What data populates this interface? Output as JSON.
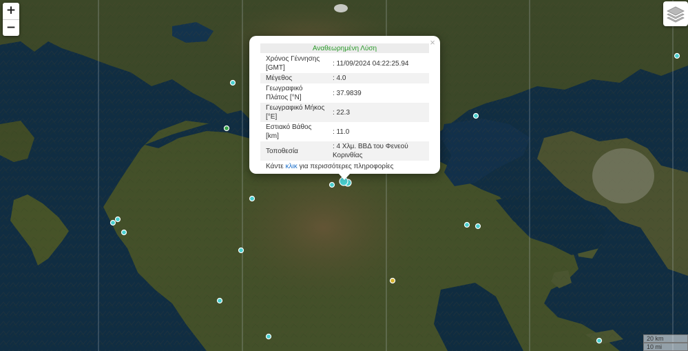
{
  "map": {
    "controls": {
      "zoom_in_label": "+",
      "zoom_out_label": "−",
      "layers_icon": "layers-icon"
    },
    "scale": {
      "km_label": "20 km",
      "mi_label": "10 mi"
    },
    "colors": {
      "sea": "#0f2c40",
      "land": "#3f4a2a",
      "marker_default": "#49cfcf",
      "marker_yellow": "#d6b32d",
      "marker_green": "#3aa64a",
      "popup_title": "#2a9a2a",
      "link": "#1a6fc9"
    },
    "markers": [
      {
        "name": "quake-marker-selected",
        "color": "#49cfcf",
        "selected": true
      },
      {
        "name": "quake-marker",
        "color": "#49cfcf"
      },
      {
        "name": "quake-marker-yellow",
        "color": "#d6b32d"
      },
      {
        "name": "quake-marker-green",
        "color": "#3aa64a"
      }
    ]
  },
  "popup": {
    "title": "Αναθεωρημένη Λύση",
    "close_label": "×",
    "rows": [
      {
        "label": "Χρόνος Γέννησης [GMT]",
        "value": ": 11/09/2024 04:22:25.94"
      },
      {
        "label": "Μέγεθος",
        "value": ": 4.0"
      },
      {
        "label": "Γεωγραφικό Πλάτος [°N]",
        "value": ": 37.9839"
      },
      {
        "label": "Γεωγραφικό Μήκος [°E]",
        "value": ": 22.3"
      },
      {
        "label": "Εστιακό Βάθος [km]",
        "value": ": 11.0"
      },
      {
        "label": "Τοποθεσία",
        "value": ": 4 Χλμ. ΒΒΔ του Φενεού Κορινθίας"
      }
    ],
    "more_prefix": "Κάντε ",
    "more_link": "κλικ",
    "more_suffix": " για περισσότερες πληροφορίες"
  }
}
